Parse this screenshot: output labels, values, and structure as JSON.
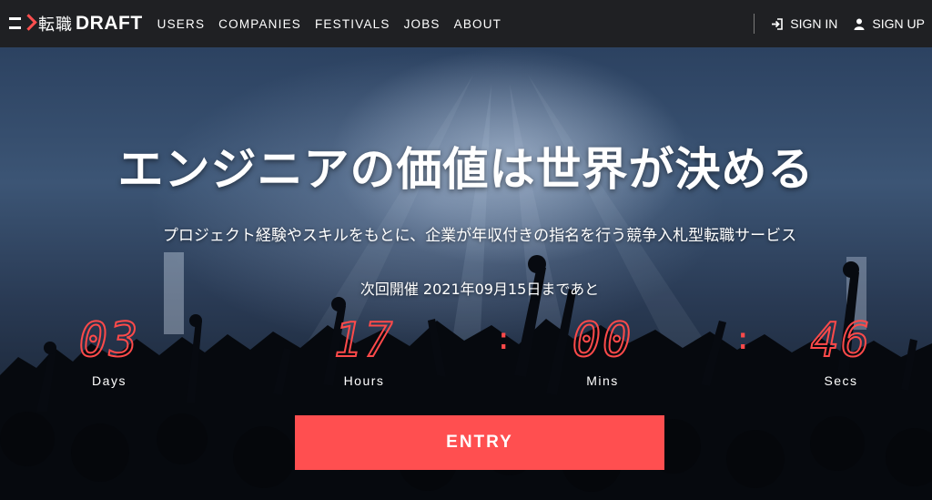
{
  "nav": {
    "logo_kanji": "転職",
    "logo_text": "DRAFT",
    "links": [
      {
        "label": "USERS"
      },
      {
        "label": "COMPANIES"
      },
      {
        "label": "FESTIVALS"
      },
      {
        "label": "JOBS"
      },
      {
        "label": "ABOUT"
      }
    ],
    "sign_in": {
      "label": "SIGN IN",
      "icon": "sign-in-icon"
    },
    "sign_up": {
      "label": "SIGN UP",
      "icon": "user-icon"
    }
  },
  "hero": {
    "title": "エンジニアの価値は世界が決める",
    "subtitle": "プロジェクト経験やスキルをもとに、企業が年収付きの指名を行う競争入札型転職サービス",
    "next_event": "次回開催 2021年09月15日まであと",
    "countdown": {
      "days": {
        "value": "03",
        "label": "Days"
      },
      "hours": {
        "value": "17",
        "label": "Hours"
      },
      "mins": {
        "value": "00",
        "label": "Mins"
      },
      "secs": {
        "value": "46",
        "label": "Secs"
      },
      "separator": ":"
    },
    "entry_label": "ENTRY"
  },
  "colors": {
    "accent": "#ff4f50",
    "nav_bg": "#1f2023",
    "countdown": "#ff4a4a"
  }
}
